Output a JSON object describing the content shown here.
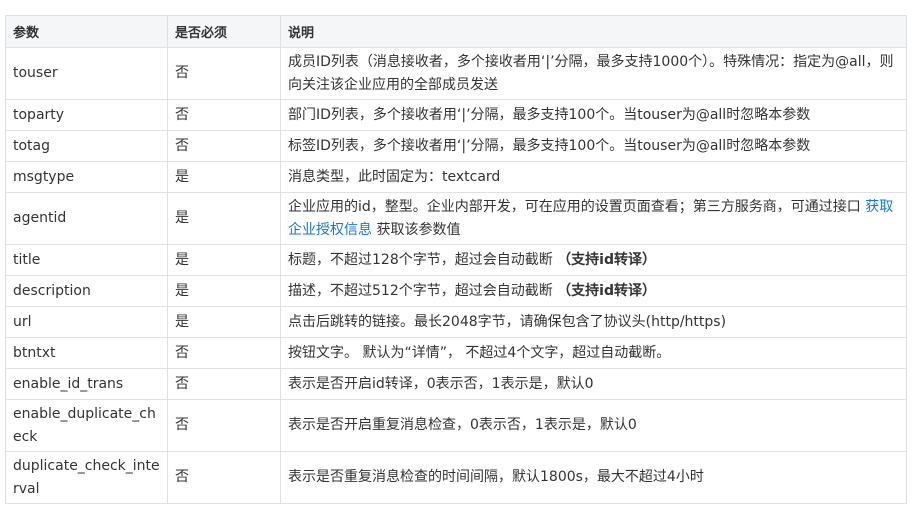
{
  "table": {
    "headers": {
      "param": "参数",
      "required": "是否必须",
      "desc": "说明"
    },
    "rows": [
      {
        "param": "touser",
        "required": "否",
        "desc": "成员ID列表（消息接收者，多个接收者用‘|’分隔，最多支持1000个）。特殊情况：指定为@all，则向关注该企业应用的全部成员发送"
      },
      {
        "param": "toparty",
        "required": "否",
        "desc": "部门ID列表，多个接收者用‘|’分隔，最多支持100个。当touser为@all时忽略本参数"
      },
      {
        "param": "totag",
        "required": "否",
        "desc": "标签ID列表，多个接收者用‘|’分隔，最多支持100个。当touser为@all时忽略本参数"
      },
      {
        "param": "msgtype",
        "required": "是",
        "desc": "消息类型，此时固定为：textcard"
      },
      {
        "param": "agentid",
        "required": "是",
        "desc_pre": "企业应用的id，整型。企业内部开发，可在应用的设置页面查看；第三方服务商，可通过接口 ",
        "desc_link": "获取企业授权信息",
        "desc_post": " 获取该参数值"
      },
      {
        "param": "title",
        "required": "是",
        "desc": "标题，不超过128个字节，超过会自动截断 ",
        "desc_bold": "（支持id转译）"
      },
      {
        "param": "description",
        "required": "是",
        "desc": "描述，不超过512个字节，超过会自动截断 ",
        "desc_bold": "（支持id转译）"
      },
      {
        "param": "url",
        "required": "是",
        "desc": "点击后跳转的链接。最长2048字节，请确保包含了协议头(http/https)"
      },
      {
        "param": "btntxt",
        "required": "否",
        "desc": "按钮文字。 默认为“详情”， 不超过4个文字，超过自动截断。"
      },
      {
        "param": "enable_id_trans",
        "required": "否",
        "desc": "表示是否开启id转译，0表示否，1表示是，默认0"
      },
      {
        "param": "enable_duplicate_check",
        "required": "否",
        "desc": "表示是否开启重复消息检查，0表示否，1表示是，默认0"
      },
      {
        "param": "duplicate_check_interval",
        "required": "否",
        "desc": "表示是否重复消息检查的时间间隔，默认1800s，最大不超过4小时"
      }
    ]
  },
  "colors": {
    "link": "#1677d6",
    "header_bg": "#f5f6f8",
    "border": "#dfe2e5"
  }
}
